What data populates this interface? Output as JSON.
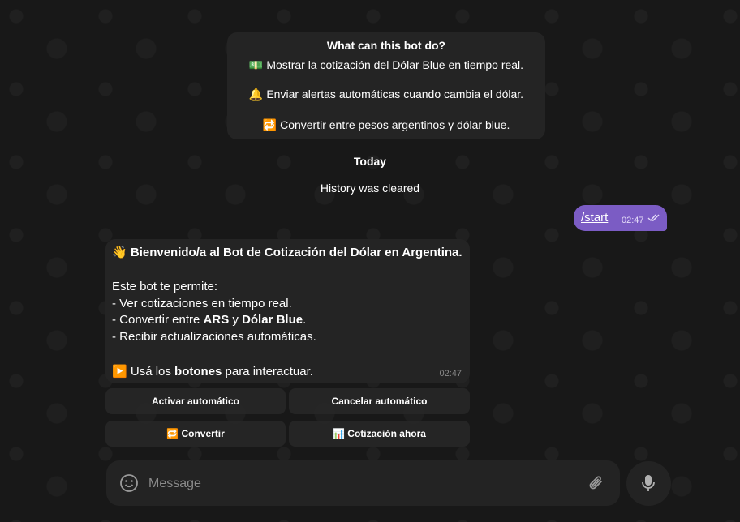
{
  "bot_info": {
    "title": "What can this bot do?",
    "lines": [
      {
        "icon": "💵",
        "text": "Mostrar la cotización del Dólar Blue en tiempo real."
      },
      {
        "icon": "🔔",
        "text": "Enviar alertas automáticas cuando cambia el dólar."
      },
      {
        "icon": "🔁",
        "text": "Convertir entre pesos argentinos y dólar blue."
      }
    ]
  },
  "date_chip": "Today",
  "service_message": "History was cleared",
  "outgoing": {
    "text": "/start",
    "time": "02:47"
  },
  "incoming": {
    "wave": "👋",
    "title": "Bienvenido/a al Bot de Cotización del Dólar en Argentina.",
    "intro": "Este bot te permite:",
    "item1": "- Ver cotizaciones en tiempo real.",
    "item2_a": "- Convertir entre ",
    "item2_b": "ARS",
    "item2_c": " y ",
    "item2_d": "Dólar Blue",
    "item2_e": ".",
    "item3": "- Recibir actualizaciones automáticas.",
    "cta_icon": "▶️",
    "cta_a": "Usá los ",
    "cta_b": "botones",
    "cta_c": " para interactuar.",
    "time": "02:47"
  },
  "keyboard": {
    "activate": "Activar automático",
    "cancel": "Cancelar automático",
    "convert_icon": "🔁",
    "convert": "Convertir",
    "quote_icon": "📊",
    "quote": "Cotización ahora"
  },
  "composer": {
    "placeholder": "Message"
  },
  "colors": {
    "background": "#181818",
    "bubble": "#242424",
    "outgoing_bubble": "#7b5cc4"
  }
}
